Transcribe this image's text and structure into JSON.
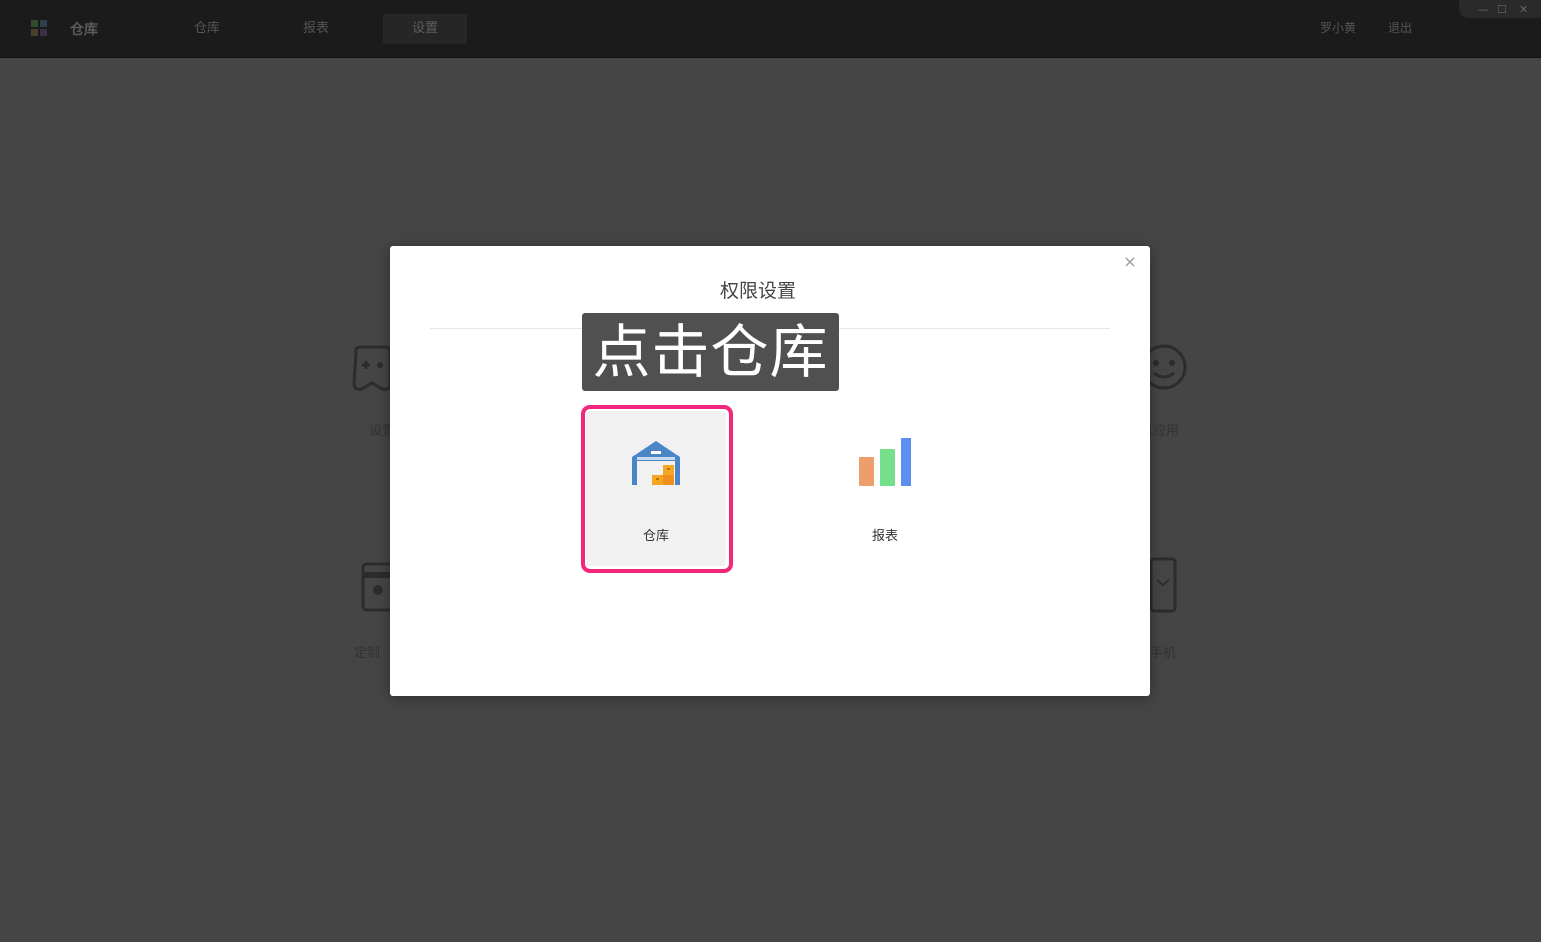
{
  "app": {
    "title": "仓库"
  },
  "nav": {
    "items": [
      "仓库",
      "报表",
      "设置"
    ],
    "active_index": 2
  },
  "user": {
    "name": "罗小黄",
    "logout": "退出"
  },
  "window_controls": {
    "minimize": "—",
    "maximize": "☐",
    "close": "✕"
  },
  "background_tiles": [
    {
      "icon": "gamepad-icon",
      "label": "设置"
    },
    {
      "icon": "smiley-face-icon",
      "label": "自应用"
    },
    {
      "icon": "coffee-cup-icon",
      "label": "定制"
    },
    {
      "icon": "mobile-phone-icon",
      "label": "手机"
    }
  ],
  "modal": {
    "title": "权限设置",
    "close": "×",
    "tiles": [
      {
        "label": "仓库",
        "icon": "warehouse-icon",
        "selected": true
      },
      {
        "label": "报表",
        "icon": "bar-chart-icon",
        "selected": false
      }
    ]
  },
  "callout": {
    "text": "点击仓库"
  },
  "colors": {
    "highlight": "#f2267a",
    "warehouse_blue": "#4a86c7",
    "box_orange": "#f5a623",
    "bar_orange": "#ee9e6a",
    "bar_green": "#74e08a",
    "bar_blue": "#5b8ff0"
  }
}
